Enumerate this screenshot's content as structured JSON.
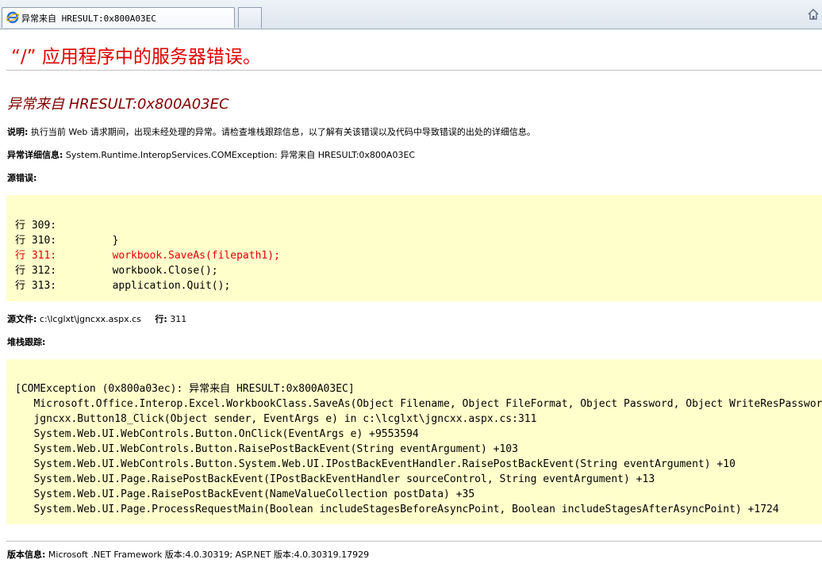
{
  "browser": {
    "tab_title": "异常来自 HRESULT:0x800A03EC",
    "icons": [
      "ie-icon",
      "home-icon"
    ]
  },
  "page": {
    "server_error_title": "“/” 应用程序中的服务器错误。",
    "error_heading": "异常来自 HRESULT:0x800A03EC",
    "description_label": "说明:",
    "description_text": " 执行当前 Web 请求期间，出现未经处理的异常。请检查堆栈跟踪信息，以了解有关该错误以及代码中导致错误的出处的详细信息。",
    "exception_label": "异常详细信息:",
    "exception_text": " System.Runtime.InteropServices.COMException: 异常来自 HRESULT:0x800A03EC",
    "source_error_label": "源错误:",
    "source_lines": [
      "行 309:",
      "行 310:         }",
      "行 311:         workbook.SaveAs(filepath1);",
      "行 312:         workbook.Close();",
      "行 313:         application.Quit();"
    ],
    "source_file_label": "源文件:",
    "source_file_value": " c:\\lcglxt\\jgncxx.aspx.cs",
    "source_line_label": "行:",
    "source_line_value": " 311",
    "stack_trace_label": "堆栈跟踪:",
    "stack_lines": [
      "[COMException (0x800a03ec): 异常来自 HRESULT:0x800A03EC]",
      "   Microsoft.Office.Interop.Excel.WorkbookClass.SaveAs(Object Filename, Object FileFormat, Object Password, Object WriteResPassword",
      "   jgncxx.Button18_Click(Object sender, EventArgs e) in c:\\lcglxt\\jgncxx.aspx.cs:311",
      "   System.Web.UI.WebControls.Button.OnClick(EventArgs e) +9553594",
      "   System.Web.UI.WebControls.Button.RaisePostBackEvent(String eventArgument) +103",
      "   System.Web.UI.WebControls.Button.System.Web.UI.IPostBackEventHandler.RaisePostBackEvent(String eventArgument) +10",
      "   System.Web.UI.Page.RaisePostBackEvent(IPostBackEventHandler sourceControl, String eventArgument) +13",
      "   System.Web.UI.Page.RaisePostBackEvent(NameValueCollection postData) +35",
      "   System.Web.UI.Page.ProcessRequestMain(Boolean includeStagesBeforeAsyncPoint, Boolean includeStagesAfterAsyncPoint) +1724"
    ],
    "version_label": "版本信息:",
    "version_text": " Microsoft .NET Framework 版本:4.0.30319; ASP.NET 版本:4.0.30319.17929"
  },
  "colors": {
    "title_red": "#e00000",
    "heading_maroon": "#800000",
    "code_background": "#ffffcc"
  }
}
